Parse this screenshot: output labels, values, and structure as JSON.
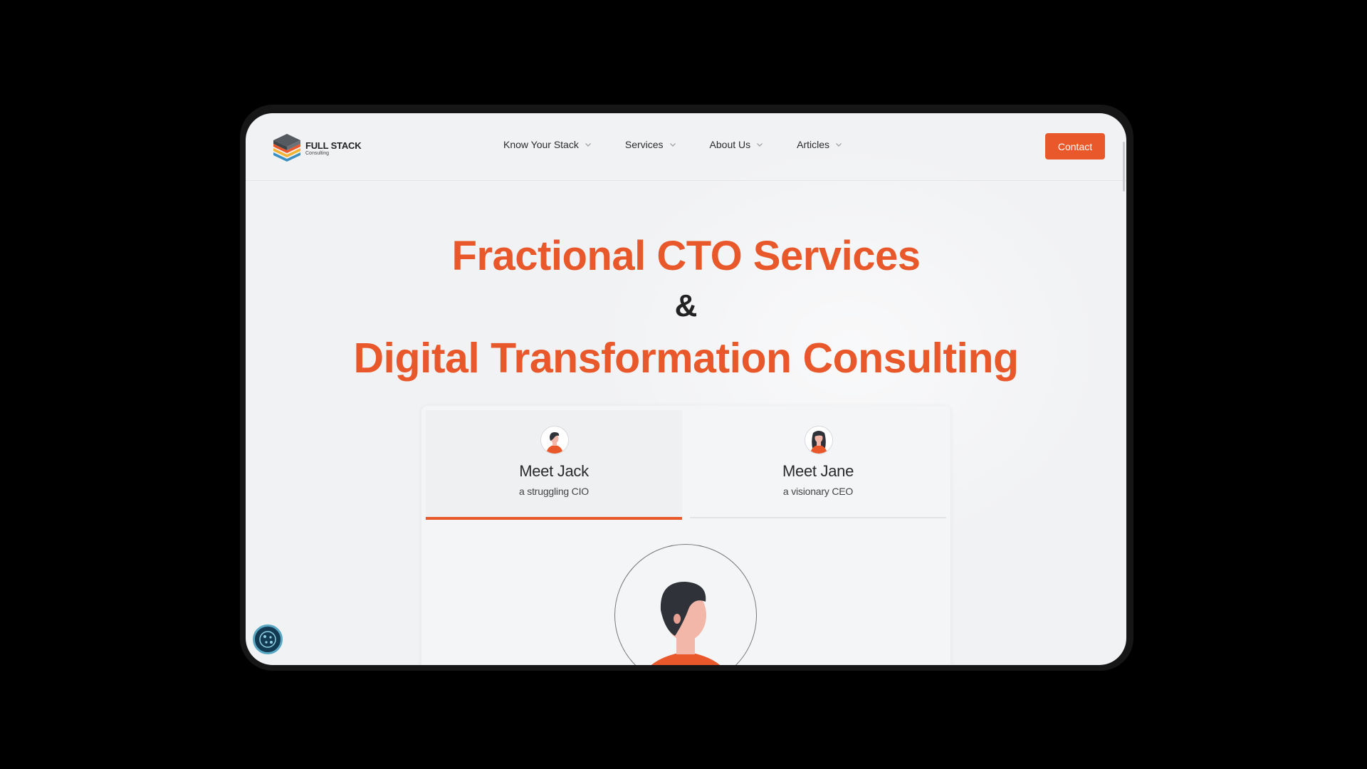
{
  "brand": {
    "title": "FULL STACK",
    "subtitle": "Consulting",
    "accent_color": "#e8582a"
  },
  "nav": {
    "items": [
      {
        "label": "Know Your Stack",
        "icon": "chevron-down-icon"
      },
      {
        "label": "Services",
        "icon": "chevron-down-icon"
      },
      {
        "label": "About Us",
        "icon": "chevron-down-icon"
      },
      {
        "label": "Articles",
        "icon": "chevron-down-icon"
      }
    ],
    "contact_label": "Contact"
  },
  "hero": {
    "line1": "Fractional CTO Services",
    "ampersand": "&",
    "line2": "Digital Transformation Consulting"
  },
  "personas": {
    "tabs": [
      {
        "name": "Meet Jack",
        "role": "a struggling CIO",
        "active": true,
        "icon": "man-avatar-icon"
      },
      {
        "name": "Meet Jane",
        "role": "a visionary CEO",
        "active": false,
        "icon": "woman-avatar-icon"
      }
    ]
  },
  "widgets": {
    "cookie_icon": "cookie-settings-icon"
  }
}
